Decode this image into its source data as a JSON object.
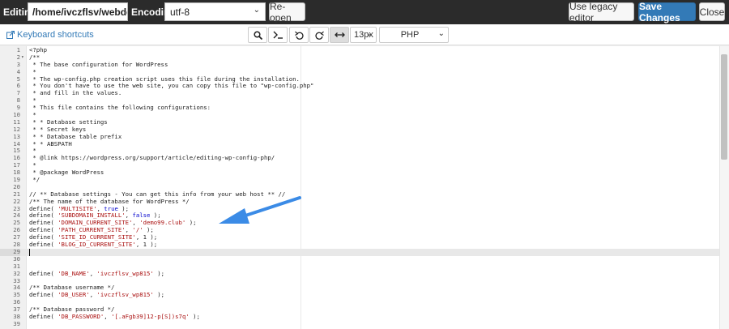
{
  "topbar": {
    "editing_label": "Editing:",
    "file_path": "/home/ivczflsv/webdemo",
    "encoding_label": "Encoding:",
    "encoding_value": "utf-8",
    "reopen_label": "Re-open",
    "legacy_label": "Use legacy editor",
    "save_label": "Save Changes",
    "close_label": "Close"
  },
  "toolbar": {
    "shortcuts_label": "Keyboard shortcuts",
    "font_size": "13px",
    "mode": "PHP"
  },
  "colors": {
    "accent": "#337ab7",
    "arrow": "#3b8be6"
  },
  "editor": {
    "active_line": 29,
    "lines": [
      {
        "n": "1",
        "t": "<?php",
        "c": ""
      },
      {
        "n": "2",
        "t": "/**",
        "c": "c-com"
      },
      {
        "n": "3",
        "t": " * The base configuration for WordPress",
        "c": "c-com"
      },
      {
        "n": "4",
        "t": " *",
        "c": "c-com"
      },
      {
        "n": "5",
        "t": " * The wp-config.php creation script uses this file during the installation.",
        "c": "c-com"
      },
      {
        "n": "6",
        "t": " * You don't have to use the web site, you can copy this file to \"wp-config.php\"",
        "c": "c-com"
      },
      {
        "n": "7",
        "t": " * and fill in the values.",
        "c": "c-com"
      },
      {
        "n": "8",
        "t": " *",
        "c": "c-com"
      },
      {
        "n": "9",
        "t": " * This file contains the following configurations:",
        "c": "c-com"
      },
      {
        "n": "10",
        "t": " *",
        "c": "c-com"
      },
      {
        "n": "11",
        "t": " * * Database settings",
        "c": "c-com"
      },
      {
        "n": "12",
        "t": " * * Secret keys",
        "c": "c-com"
      },
      {
        "n": "13",
        "t": " * * Database table prefix",
        "c": "c-com"
      },
      {
        "n": "14",
        "t": " * * ABSPATH",
        "c": "c-com"
      },
      {
        "n": "15",
        "t": " *",
        "c": "c-com"
      },
      {
        "n": "16",
        "t": " * @link https://wordpress.org/support/article/editing-wp-config-php/",
        "c": "c-com"
      },
      {
        "n": "17",
        "t": " *",
        "c": "c-com"
      },
      {
        "n": "18",
        "t": " * @package WordPress",
        "c": "c-com"
      },
      {
        "n": "19",
        "t": " */",
        "c": "c-com"
      },
      {
        "n": "20",
        "t": "",
        "c": ""
      },
      {
        "n": "21",
        "t": "// ** Database settings - You can get this info from your web host ** //",
        "c": "c-com"
      },
      {
        "n": "22",
        "t": "/** The name of the database for WordPress */",
        "c": "c-com"
      },
      {
        "n": "23",
        "t": "define( 'MULTISITE', true );",
        "c": ""
      },
      {
        "n": "24",
        "t": "define( 'SUBDOMAIN_INSTALL', false );",
        "c": ""
      },
      {
        "n": "25",
        "t": "define( 'DOMAIN_CURRENT_SITE', 'demo99.club' );",
        "c": ""
      },
      {
        "n": "26",
        "t": "define( 'PATH_CURRENT_SITE', '/' );",
        "c": ""
      },
      {
        "n": "27",
        "t": "define( 'SITE_ID_CURRENT_SITE', 1 );",
        "c": ""
      },
      {
        "n": "28",
        "t": "define( 'BLOG_ID_CURRENT_SITE', 1 );",
        "c": ""
      },
      {
        "n": "29",
        "t": "",
        "c": ""
      },
      {
        "n": "30",
        "t": "",
        "c": ""
      },
      {
        "n": "31",
        "t": "",
        "c": ""
      },
      {
        "n": "32",
        "t": "define( 'DB_NAME', 'ivczflsv_wp815' );",
        "c": ""
      },
      {
        "n": "33",
        "t": "",
        "c": ""
      },
      {
        "n": "34",
        "t": "/** Database username */",
        "c": "c-com"
      },
      {
        "n": "35",
        "t": "define( 'DB_USER', 'ivczflsv_wp815' );",
        "c": ""
      },
      {
        "n": "36",
        "t": "",
        "c": ""
      },
      {
        "n": "37",
        "t": "/** Database password */",
        "c": "c-com"
      },
      {
        "n": "38",
        "t": "define( 'DB_PASSWORD', '[.aFgb39]12-p[S])s7q' );",
        "c": ""
      },
      {
        "n": "39",
        "t": "",
        "c": ""
      }
    ]
  }
}
